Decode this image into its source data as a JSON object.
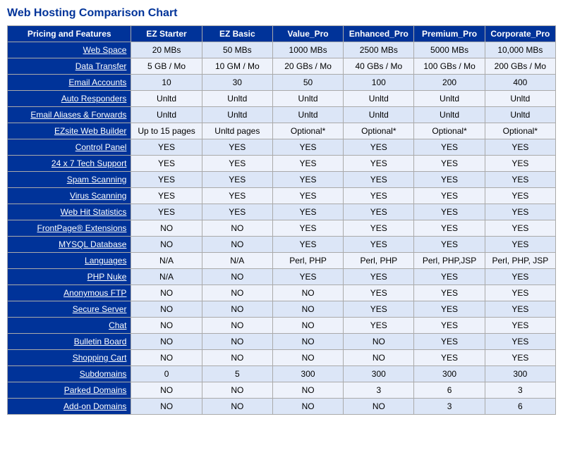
{
  "title": "Web Hosting Comparison Chart",
  "columns": [
    "Pricing and Features",
    "EZ Starter",
    "EZ Basic",
    "Value_Pro",
    "Enhanced_Pro",
    "Premium_Pro",
    "Corporate_Pro"
  ],
  "rows": [
    {
      "feature": "Web Space",
      "ez_starter": "20 MBs",
      "ez_basic": "50 MBs",
      "value_pro": "1000 MBs",
      "enhanced_pro": "2500 MBs",
      "premium_pro": "5000 MBs",
      "corporate_pro": "10,000 MBs"
    },
    {
      "feature": "Data Transfer",
      "ez_starter": "5 GB / Mo",
      "ez_basic": "10 GM / Mo",
      "value_pro": "20 GBs / Mo",
      "enhanced_pro": "40 GBs / Mo",
      "premium_pro": "100 GBs / Mo",
      "corporate_pro": "200 GBs / Mo"
    },
    {
      "feature": "Email Accounts",
      "ez_starter": "10",
      "ez_basic": "30",
      "value_pro": "50",
      "enhanced_pro": "100",
      "premium_pro": "200",
      "corporate_pro": "400"
    },
    {
      "feature": "Auto Responders",
      "ez_starter": "Unltd",
      "ez_basic": "Unltd",
      "value_pro": "Unltd",
      "enhanced_pro": "Unltd",
      "premium_pro": "Unltd",
      "corporate_pro": "Unltd"
    },
    {
      "feature": "Email Aliases & Forwards",
      "ez_starter": "Unltd",
      "ez_basic": "Unltd",
      "value_pro": "Unltd",
      "enhanced_pro": "Unltd",
      "premium_pro": "Unltd",
      "corporate_pro": "Unltd"
    },
    {
      "feature": "EZsite Web Builder",
      "ez_starter": "Up to 15 pages",
      "ez_basic": "Unltd pages",
      "value_pro": "Optional*",
      "enhanced_pro": "Optional*",
      "premium_pro": "Optional*",
      "corporate_pro": "Optional*"
    },
    {
      "feature": "Control Panel",
      "ez_starter": "YES",
      "ez_basic": "YES",
      "value_pro": "YES",
      "enhanced_pro": "YES",
      "premium_pro": "YES",
      "corporate_pro": "YES"
    },
    {
      "feature": "24 x 7 Tech Support",
      "ez_starter": "YES",
      "ez_basic": "YES",
      "value_pro": "YES",
      "enhanced_pro": "YES",
      "premium_pro": "YES",
      "corporate_pro": "YES"
    },
    {
      "feature": "Spam Scanning",
      "ez_starter": "YES",
      "ez_basic": "YES",
      "value_pro": "YES",
      "enhanced_pro": "YES",
      "premium_pro": "YES",
      "corporate_pro": "YES"
    },
    {
      "feature": "Virus Scanning",
      "ez_starter": "YES",
      "ez_basic": "YES",
      "value_pro": "YES",
      "enhanced_pro": "YES",
      "premium_pro": "YES",
      "corporate_pro": "YES"
    },
    {
      "feature": "Web Hit Statistics",
      "ez_starter": "YES",
      "ez_basic": "YES",
      "value_pro": "YES",
      "enhanced_pro": "YES",
      "premium_pro": "YES",
      "corporate_pro": "YES"
    },
    {
      "feature": "FrontPage® Extensions",
      "ez_starter": "NO",
      "ez_basic": "NO",
      "value_pro": "YES",
      "enhanced_pro": "YES",
      "premium_pro": "YES",
      "corporate_pro": "YES"
    },
    {
      "feature": "MYSQL Database",
      "ez_starter": "NO",
      "ez_basic": "NO",
      "value_pro": "YES",
      "enhanced_pro": "YES",
      "premium_pro": "YES",
      "corporate_pro": "YES"
    },
    {
      "feature": "Languages",
      "ez_starter": "N/A",
      "ez_basic": "N/A",
      "value_pro": "Perl, PHP",
      "enhanced_pro": "Perl, PHP",
      "premium_pro": "Perl, PHP,JSP",
      "corporate_pro": "Perl, PHP, JSP"
    },
    {
      "feature": "PHP Nuke",
      "ez_starter": "N/A",
      "ez_basic": "NO",
      "value_pro": "YES",
      "enhanced_pro": "YES",
      "premium_pro": "YES",
      "corporate_pro": "YES"
    },
    {
      "feature": "Anonymous FTP",
      "ez_starter": "NO",
      "ez_basic": "NO",
      "value_pro": "NO",
      "enhanced_pro": "YES",
      "premium_pro": "YES",
      "corporate_pro": "YES"
    },
    {
      "feature": "Secure Server",
      "ez_starter": "NO",
      "ez_basic": "NO",
      "value_pro": "NO",
      "enhanced_pro": "YES",
      "premium_pro": "YES",
      "corporate_pro": "YES"
    },
    {
      "feature": "Chat",
      "ez_starter": "NO",
      "ez_basic": "NO",
      "value_pro": "NO",
      "enhanced_pro": "YES",
      "premium_pro": "YES",
      "corporate_pro": "YES"
    },
    {
      "feature": "Bulletin Board",
      "ez_starter": "NO",
      "ez_basic": "NO",
      "value_pro": "NO",
      "enhanced_pro": "NO",
      "premium_pro": "YES",
      "corporate_pro": "YES"
    },
    {
      "feature": "Shopping Cart",
      "ez_starter": "NO",
      "ez_basic": "NO",
      "value_pro": "NO",
      "enhanced_pro": "NO",
      "premium_pro": "YES",
      "corporate_pro": "YES"
    },
    {
      "feature": "Subdomains",
      "ez_starter": "0",
      "ez_basic": "5",
      "value_pro": "300",
      "enhanced_pro": "300",
      "premium_pro": "300",
      "corporate_pro": "300"
    },
    {
      "feature": "Parked Domains",
      "ez_starter": "NO",
      "ez_basic": "NO",
      "value_pro": "NO",
      "enhanced_pro": "3",
      "premium_pro": "6",
      "corporate_pro": "3"
    },
    {
      "feature": "Add-on Domains",
      "ez_starter": "NO",
      "ez_basic": "NO",
      "value_pro": "NO",
      "enhanced_pro": "NO",
      "premium_pro": "3",
      "corporate_pro": "6"
    }
  ]
}
